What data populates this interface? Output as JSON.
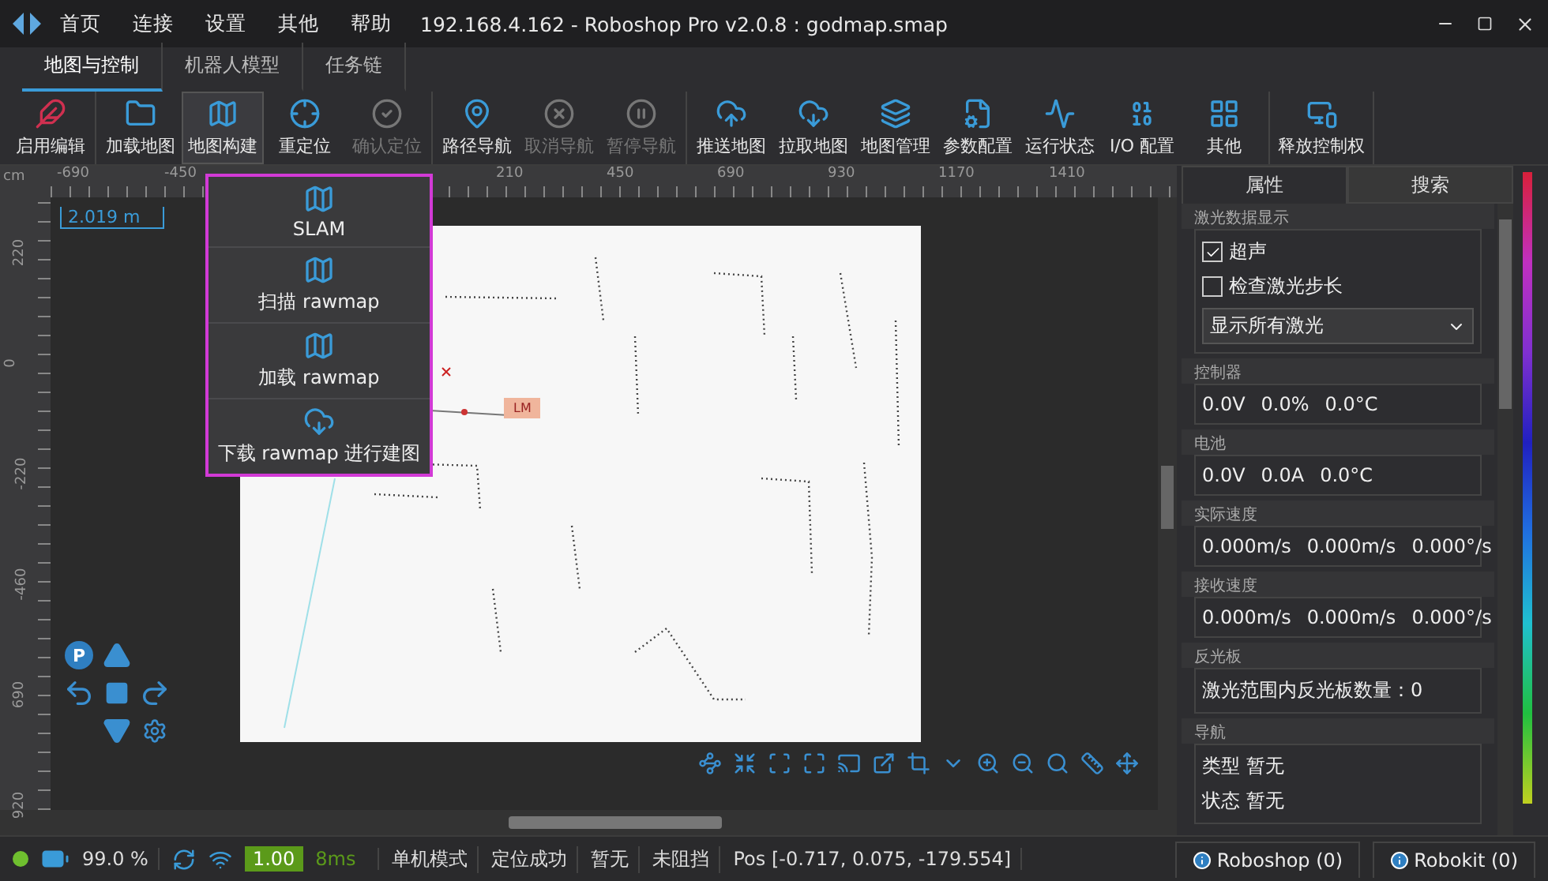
{
  "menu_bar": {
    "items": [
      "首页",
      "连接",
      "设置",
      "其他",
      "帮助"
    ],
    "title": "192.168.4.162 - Roboshop Pro v2.0.8 : godmap.smap"
  },
  "tabs": [
    {
      "label": "地图与控制",
      "selected": true
    },
    {
      "label": "机器人模型",
      "selected": false
    },
    {
      "label": "任务链",
      "selected": false
    }
  ],
  "toolbar": {
    "groups": [
      [
        {
          "label": "启用编辑",
          "selected": false,
          "disabled": false
        }
      ],
      [
        {
          "label": "加载地图",
          "selected": false,
          "disabled": false
        },
        {
          "label": "地图构建",
          "selected": true,
          "disabled": false
        },
        {
          "label": "重定位",
          "selected": false,
          "disabled": false
        },
        {
          "label": "确认定位",
          "selected": false,
          "disabled": true
        }
      ],
      [
        {
          "label": "路径导航",
          "selected": false,
          "disabled": false
        },
        {
          "label": "取消导航",
          "selected": false,
          "disabled": true
        },
        {
          "label": "暂停导航",
          "selected": false,
          "disabled": true
        }
      ],
      [
        {
          "label": "推送地图",
          "selected": false,
          "disabled": false
        },
        {
          "label": "拉取地图",
          "selected": false,
          "disabled": false
        },
        {
          "label": "地图管理",
          "selected": false,
          "disabled": false
        },
        {
          "label": "参数配置",
          "selected": false,
          "disabled": false
        },
        {
          "label": "运行状态",
          "selected": false,
          "disabled": false
        },
        {
          "label": "I/O 配置",
          "selected": false,
          "disabled": false
        },
        {
          "label": "其他",
          "selected": false,
          "disabled": false
        }
      ],
      [
        {
          "label": "释放控制权",
          "selected": false,
          "disabled": false
        }
      ]
    ]
  },
  "build_menu": {
    "items": [
      "SLAM",
      "扫描 rawmap",
      "加载 rawmap",
      "下载 rawmap 进行建图"
    ]
  },
  "map_view": {
    "unit": "cm",
    "x_ruler": [
      "-690",
      "-450",
      "210",
      "450",
      "690",
      "930",
      "1170",
      "1410"
    ],
    "y_ruler": [
      "220",
      "0",
      "-220",
      "-460",
      "690",
      "920"
    ],
    "scale": "2.019 m",
    "landmark": "LM",
    "pad_label": "P"
  },
  "side_panel": {
    "tabs": [
      {
        "label": "属性",
        "selected": true
      },
      {
        "label": "搜索",
        "selected": false
      }
    ],
    "groups": [
      {
        "kind": "settings",
        "title": "激光数据显示",
        "checks": [
          {
            "label": "超声",
            "checked": true
          },
          {
            "label": "检查激光步长",
            "checked": false
          }
        ],
        "select": "显示所有激光"
      },
      {
        "kind": "values",
        "title": "控制器",
        "values": [
          "0.0V",
          "0.0%",
          "0.0°C"
        ]
      },
      {
        "kind": "values",
        "title": "电池",
        "values": [
          "0.0V",
          "0.0A",
          "0.0°C"
        ]
      },
      {
        "kind": "values",
        "title": "实际速度",
        "values": [
          "0.000m/s",
          "0.000m/s",
          "0.000°/s"
        ]
      },
      {
        "kind": "values",
        "title": "接收速度",
        "values": [
          "0.000m/s",
          "0.000m/s",
          "0.000°/s"
        ]
      },
      {
        "kind": "lines",
        "title": "反光板",
        "lines": [
          "激光范围内反光板数量：0"
        ]
      },
      {
        "kind": "lines",
        "title": "导航",
        "lines": [
          "类型  暂无",
          "状态  暂无"
        ]
      }
    ]
  },
  "status_bar": {
    "online": true,
    "battery": "99.0 %",
    "speed": "1.00",
    "latency": "8ms",
    "fields": [
      "单机模式",
      "定位成功",
      "暂无",
      "未阻挡",
      "Pos [-0.717, 0.075, -179.554]"
    ]
  },
  "log_tabs": [
    "Roboshop (0)",
    "Robokit (0)"
  ]
}
